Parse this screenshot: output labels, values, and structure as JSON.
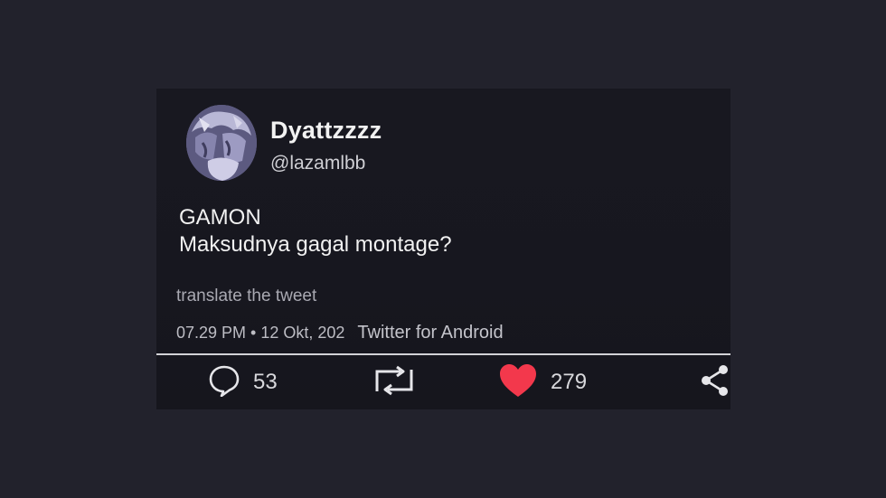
{
  "tweet": {
    "display_name": "Dyattzzzz",
    "handle": "@lazamlbb",
    "text_lines": [
      "GAMON",
      "Maksudnya gagal montage?"
    ],
    "translate_label": "translate the tweet",
    "timestamp": "07.29 PM • 12 Okt, 202",
    "source": "Twitter for Android"
  },
  "actions": {
    "reply_count": "53",
    "like_count": "279"
  },
  "icons": {
    "reply": "speech-bubble-icon",
    "retweet": "retweet-icon",
    "like": "heart-icon",
    "share": "share-icon"
  },
  "colors": {
    "background": "#22222c",
    "card": "#18181f",
    "like_heart": "#f3384c",
    "text": "#f1f1f1"
  }
}
